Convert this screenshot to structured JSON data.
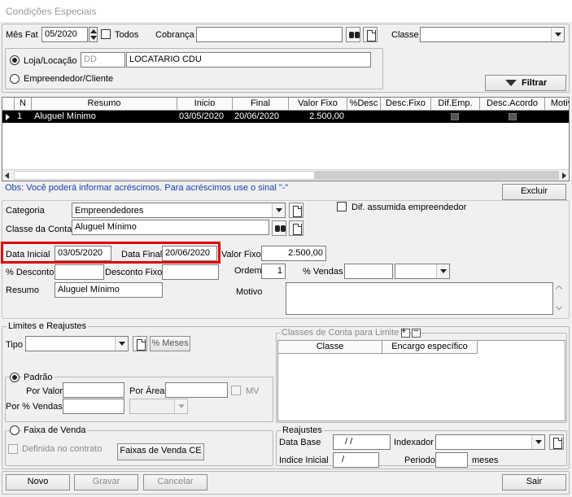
{
  "window": {
    "title": "Condições Especiais"
  },
  "filter": {
    "mes_fat_label": "Mês Fat",
    "mes_fat_value": "05/2020",
    "todos_label": "Todos",
    "cobranca_label": "Cobrança",
    "cobranca_value": "",
    "classe_label": "Classe",
    "classe_value": "",
    "loja_label": "Loja/Locação",
    "loja_code": "DD",
    "loja_name": "LOCATARIO CDU",
    "empreendedor_label": "Empreendedor/Cliente",
    "filtrar_label": "Filtrar"
  },
  "grid": {
    "columns": [
      "N",
      "Resumo",
      "Inicio",
      "Final",
      "Valor Fixo",
      "%Desc",
      "Desc.Fixo",
      "Dif.Emp.",
      "Desc.Acordo",
      "Motiv"
    ],
    "rows": [
      {
        "n": "1",
        "resumo": "Aluguel Mínimo",
        "inicio": "03/05/2020",
        "final": "20/06/2020",
        "valor_fixo": "2.500,00",
        "desc": "",
        "desc_fixo": ""
      }
    ]
  },
  "obs": "Obs: Você poderá informar acréscimos. Para acréscimos use o sinal \"-\"",
  "excluir_label": "Excluir",
  "form": {
    "categoria_label": "Categoria",
    "categoria_value": "Empreendedores",
    "dif_assumida_label": "Dif. assumida empreendedor",
    "classe_conta_label": "Classe da Conta",
    "classe_conta_value": "Aluguel Mínimo",
    "data_inicial_label": "Data Inicial",
    "data_inicial_value": "03/05/2020",
    "data_final_label": "Data Final",
    "data_final_value": "20/06/2020",
    "valor_fixo_label": "Valor Fixo",
    "valor_fixo_value": "2.500,00",
    "desconto_label": "% Desconto",
    "desconto_value": "",
    "desconto_fixo_label": "Desconto Fixo",
    "desconto_fixo_value": "",
    "ordem_label": "Ordem",
    "ordem_value": "1",
    "vendas_label": "% Vendas",
    "vendas_value": "",
    "resumo_label": "Resumo",
    "resumo_value": "Aluguel Mínimo",
    "motivo_label": "Motivo",
    "motivo_value": ""
  },
  "limites": {
    "title": "Limites e Reajustes",
    "tipo_label": "Tipo",
    "meses_label": "% Meses",
    "padrao_label": "Padrão",
    "por_valor_label": "Por Valor",
    "por_area_label": "Por Área",
    "mv_label": "MV",
    "por_vendas_label": "Por % Vendas",
    "faixa_label": "Faixa de Venda",
    "definida_label": "Definida no contrato",
    "faixas_btn_label": "Faixas de Venda CE"
  },
  "classes_limite": {
    "title": "Classes de Conta para Limite",
    "columns": [
      "Classe",
      "Encargo específico"
    ]
  },
  "reajustes": {
    "title": "Reajustes",
    "data_base_label": "Data Base",
    "data_base_value": "/ /",
    "indexador_label": "Indexador",
    "indexador_value": "",
    "indice_inicial_label": "Indice Inicial",
    "indice_inicial_value": "/",
    "periodo_label": "Periodo",
    "periodo_value": "",
    "meses_label": "meses"
  },
  "footer": {
    "novo_label": "Novo",
    "gravar_label": "Gravar",
    "cancelar_label": "Cancelar",
    "sair_label": "Sair"
  }
}
